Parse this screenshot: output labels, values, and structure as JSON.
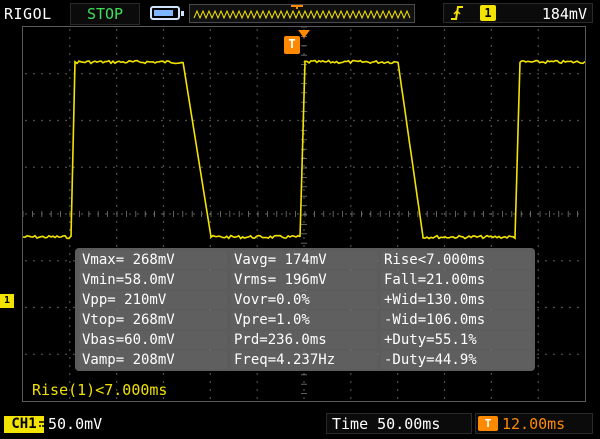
{
  "top_bar": {
    "brand": "RIGOL",
    "run_state": "STOP",
    "trigger_source": "1",
    "trigger_level": "184mV"
  },
  "channel": {
    "marker": "1",
    "badge": "CH1",
    "scale": "50.0mV",
    "color": "#f3e400"
  },
  "measurements": {
    "rows": [
      [
        "Vmax= 268mV",
        "Vavg= 174mV",
        "Rise<7.000ms"
      ],
      [
        "Vmin=58.0mV",
        "Vrms= 196mV",
        "Fall=21.00ms"
      ],
      [
        "Vpp= 210mV",
        "Vovr=0.0%",
        "+Wid=130.0ms"
      ],
      [
        "Vtop= 268mV",
        "Vpre=1.0%",
        "-Wid=106.0ms"
      ],
      [
        "Vbas=60.0mV",
        "Prd=236.0ms",
        "+Duty=55.1%"
      ],
      [
        "Vamp= 208mV",
        "Freq=4.237Hz",
        "-Duty=44.9%"
      ]
    ]
  },
  "status": {
    "rise_readout": "Rise(1)<7.000ms"
  },
  "bottom_bar": {
    "time_label": "Time 50.00ms",
    "trigger_offset": "12.00ms",
    "trigger_offset_icon": "T"
  },
  "trigger_marker": "T",
  "icons": {
    "battery": "battery-icon",
    "edge": "rising-edge-icon"
  }
}
